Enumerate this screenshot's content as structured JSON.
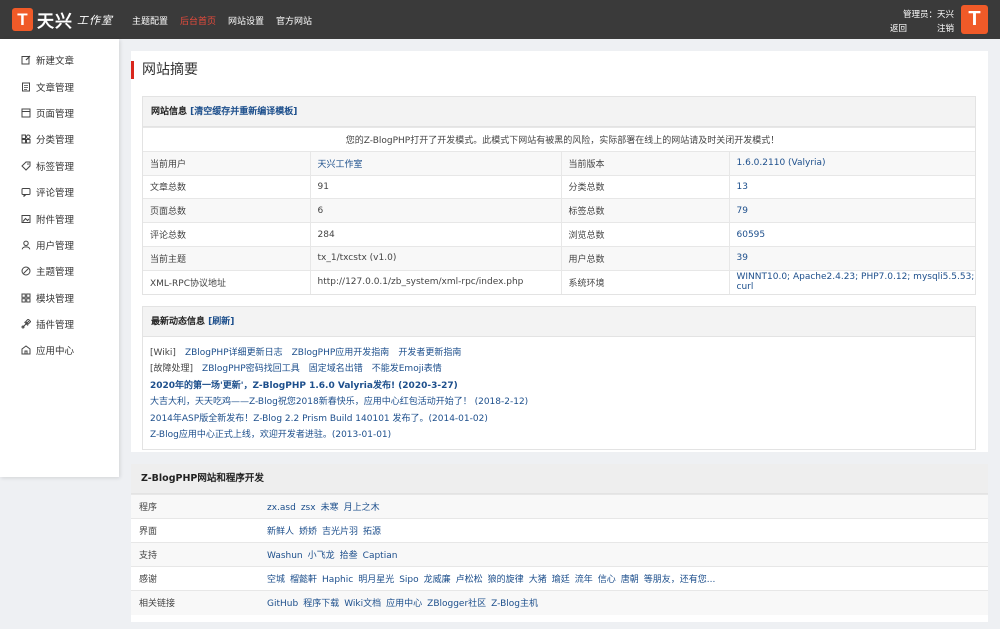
{
  "brand": {
    "mark": "T",
    "name": "天兴",
    "sub": "工作室"
  },
  "topnav": [
    {
      "label": "主题配置",
      "active": false
    },
    {
      "label": "后台首页",
      "active": true
    },
    {
      "label": "网站设置",
      "active": false
    },
    {
      "label": "官方网站",
      "active": false
    }
  ],
  "admin": {
    "role_label": "管理员：",
    "name": "天兴",
    "back_label": "返回",
    "logout_label": "注销",
    "avatar": "T"
  },
  "sidebar": {
    "items": [
      {
        "label": "新建文章",
        "icon": "edit-icon"
      },
      {
        "label": "文章管理",
        "icon": "file-icon"
      },
      {
        "label": "页面管理",
        "icon": "page-icon"
      },
      {
        "label": "分类管理",
        "icon": "category-icon"
      },
      {
        "label": "标签管理",
        "icon": "tag-icon"
      },
      {
        "label": "评论管理",
        "icon": "comment-icon"
      },
      {
        "label": "附件管理",
        "icon": "image-icon"
      },
      {
        "label": "用户管理",
        "icon": "user-icon"
      },
      {
        "label": "主题管理",
        "icon": "theme-icon"
      },
      {
        "label": "模块管理",
        "icon": "module-icon"
      },
      {
        "label": "插件管理",
        "icon": "plugin-icon"
      },
      {
        "label": "应用中心",
        "icon": "app-icon"
      }
    ]
  },
  "main": {
    "title": "网站摘要",
    "site_info": {
      "head": "网站信息",
      "head_link": "[清空缓存并重新编译模板]",
      "notice": "您的Z-BlogPHP打开了开发模式。此模式下网站有被黑的风险，实际部署在线上的网站请及时关闭开发模式！",
      "rows": [
        {
          "k1": "当前用户",
          "v1": "天兴工作室",
          "k2": "当前版本",
          "v2": "1.6.0.2110 (Valyria)"
        },
        {
          "k1": "文章总数",
          "v1": "91",
          "k2": "分类总数",
          "v2": "13"
        },
        {
          "k1": "页面总数",
          "v1": "6",
          "k2": "标签总数",
          "v2": "79"
        },
        {
          "k1": "评论总数",
          "v1": "284",
          "k2": "浏览总数",
          "v2": "60595"
        },
        {
          "k1": "当前主题",
          "v1": "tx_1/txcstx (v1.0)",
          "k2": "用户总数",
          "v2": "39"
        },
        {
          "k1": "XML-RPC协议地址",
          "v1": "http://127.0.0.1/zb_system/xml-rpc/index.php",
          "k2": "系统环境",
          "v2": "WINNT10.0; Apache2.4.23; PHP7.0.12; mysqli5.5.53; curl"
        }
      ]
    },
    "news": {
      "head": "最新动态信息",
      "head_link": "[刷新]",
      "wiki": [
        "[Wiki]",
        "ZBlogPHP详细更新日志",
        "ZBlogPHP应用开发指南",
        "开发者更新指南"
      ],
      "fault": [
        "[故障处理]",
        "ZBlogPHP密码找回工具",
        "固定域名出错",
        "不能发Emoji表情"
      ],
      "lines": [
        "2020年的第一场'更新'，Z-BlogPHP 1.6.0 Valyria发布! (2020-3-27)",
        "大吉大利，天天吃鸡——Z-Blog祝您2018新春快乐，应用中心红包活动开始了！ (2018-2-12)",
        "2014年ASP版全新发布！Z-Blog 2.2 Prism Build 140101 发布了。(2014-01-02)",
        "Z-Blog应用中心正式上线，欢迎开发者进驻。(2013-01-01)"
      ]
    }
  },
  "credits": {
    "head": "Z-BlogPHP网站和程序开发",
    "rows": [
      {
        "k": "程序",
        "v": [
          "zx.asd",
          "zsx",
          "未寒",
          "月上之木"
        ]
      },
      {
        "k": "界面",
        "v": [
          "新鲜人",
          "娇娇",
          "吉光片羽",
          "拓源"
        ]
      },
      {
        "k": "支持",
        "v": [
          "Washun",
          "小飞龙",
          "拾叁",
          "Captian"
        ]
      },
      {
        "k": "感谢",
        "v": [
          "空城",
          "榴懿軒",
          "Haphic",
          "明月星光",
          "Sipo",
          "龙威廉",
          "卢松松",
          "狼的旋律",
          "大猪",
          "瑜廷",
          "流年",
          "信心",
          "唐朝",
          "等朋友，还有您..."
        ]
      },
      {
        "k": "相关链接",
        "v": [
          "GitHub",
          "程序下载",
          "Wiki文档",
          "应用中心",
          "ZBlogger社区",
          "Z-Blog主机"
        ]
      }
    ]
  }
}
